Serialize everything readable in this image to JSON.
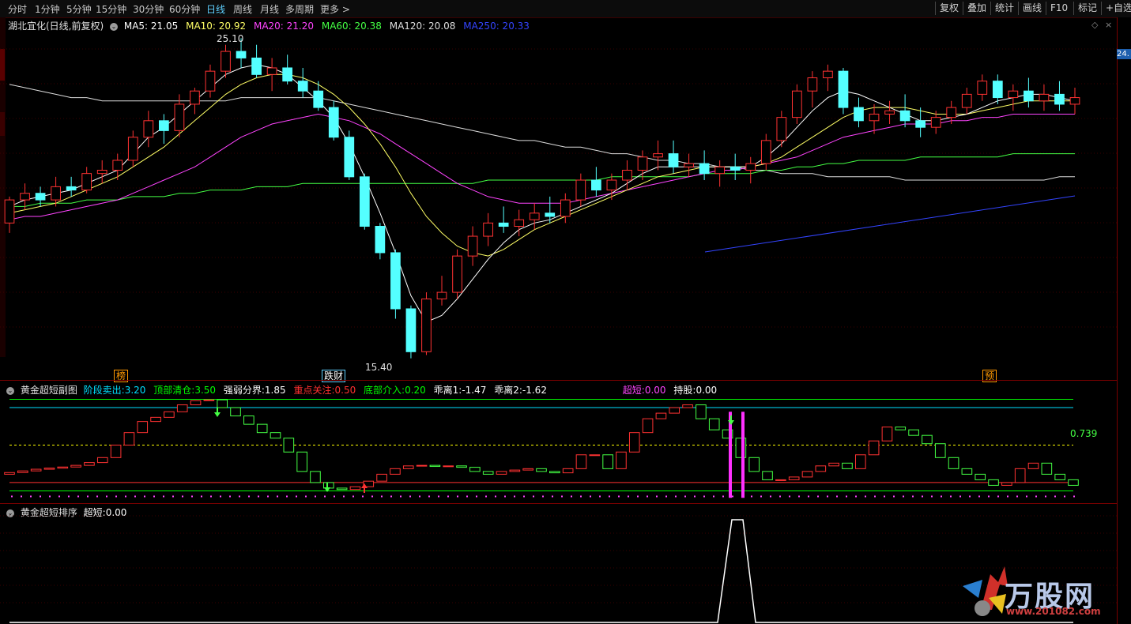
{
  "toolbar": {
    "periods": [
      "分时",
      "1分钟",
      "5分钟",
      "15分钟",
      "30分钟",
      "60分钟",
      "日线",
      "周线",
      "月线",
      "多周期",
      "更多 >"
    ],
    "active_period": "日线",
    "buttons": [
      "复权",
      "叠加",
      "统计",
      "画线",
      "F10",
      "标记",
      "+自选"
    ],
    "close": "×"
  },
  "main_chart": {
    "title": "湖北宜化(日线,前复权)",
    "ma": [
      {
        "label": "MA5: 21.05",
        "color": "#ffffff"
      },
      {
        "label": "MA10: 20.92",
        "color": "#ffff66"
      },
      {
        "label": "MA20: 21.20",
        "color": "#ff44ff"
      },
      {
        "label": "MA60: 20.38",
        "color": "#44ff44"
      },
      {
        "label": "MA120: 20.08",
        "color": "#dddddd"
      },
      {
        "label": "MA250: 20.33",
        "color": "#3344ff"
      }
    ],
    "high_label": "25.10",
    "low_label": "15.40",
    "current_price": "24.",
    "tags": [
      {
        "text": "榜",
        "color": "#ff9900"
      },
      {
        "text": "跌财",
        "color": "#ffffff"
      },
      {
        "text": "预",
        "color": "#ff9900"
      }
    ],
    "ohlc": [
      [
        19.5,
        20.3,
        19.2,
        20.2
      ],
      [
        20.2,
        20.7,
        19.9,
        20.4
      ],
      [
        20.4,
        20.6,
        20.0,
        20.2
      ],
      [
        20.2,
        20.9,
        20.0,
        20.6
      ],
      [
        20.6,
        20.9,
        20.3,
        20.5
      ],
      [
        20.5,
        21.2,
        20.4,
        21.0
      ],
      [
        21.0,
        21.4,
        20.7,
        21.1
      ],
      [
        21.1,
        21.6,
        20.8,
        21.4
      ],
      [
        21.4,
        22.3,
        21.2,
        22.1
      ],
      [
        22.1,
        22.9,
        21.8,
        22.6
      ],
      [
        22.6,
        22.8,
        21.9,
        22.3
      ],
      [
        22.3,
        23.4,
        22.1,
        23.1
      ],
      [
        23.1,
        23.6,
        22.8,
        23.5
      ],
      [
        23.5,
        24.3,
        23.3,
        24.1
      ],
      [
        24.1,
        24.9,
        23.9,
        24.7
      ],
      [
        24.7,
        25.1,
        24.2,
        24.5
      ],
      [
        24.5,
        24.9,
        23.9,
        24.0
      ],
      [
        24.0,
        24.5,
        23.5,
        24.2
      ],
      [
        24.2,
        24.6,
        23.7,
        23.8
      ],
      [
        23.8,
        24.2,
        23.3,
        23.5
      ],
      [
        23.5,
        23.8,
        22.9,
        23.0
      ],
      [
        23.0,
        23.2,
        22.0,
        22.1
      ],
      [
        22.1,
        22.3,
        20.8,
        20.9
      ],
      [
        20.9,
        21.0,
        19.3,
        19.4
      ],
      [
        19.4,
        19.5,
        18.4,
        18.6
      ],
      [
        18.6,
        18.7,
        16.6,
        16.9
      ],
      [
        16.9,
        17.0,
        15.4,
        15.6
      ],
      [
        15.6,
        17.4,
        15.5,
        17.2
      ],
      [
        17.2,
        17.9,
        17.0,
        17.4
      ],
      [
        17.4,
        18.7,
        17.2,
        18.5
      ],
      [
        18.5,
        19.4,
        18.2,
        19.1
      ],
      [
        19.1,
        19.8,
        18.8,
        19.5
      ],
      [
        19.5,
        20.0,
        19.2,
        19.4
      ],
      [
        19.4,
        19.9,
        19.1,
        19.6
      ],
      [
        19.6,
        20.1,
        19.3,
        19.8
      ],
      [
        19.8,
        20.3,
        19.5,
        19.7
      ],
      [
        19.7,
        20.4,
        19.5,
        20.2
      ],
      [
        20.2,
        21.0,
        20.0,
        20.8
      ],
      [
        20.8,
        21.2,
        20.3,
        20.5
      ],
      [
        20.5,
        21.0,
        20.2,
        20.8
      ],
      [
        20.8,
        21.4,
        20.5,
        21.1
      ],
      [
        21.1,
        21.7,
        20.8,
        21.5
      ],
      [
        21.5,
        22.0,
        21.1,
        21.6
      ],
      [
        21.6,
        22.0,
        21.0,
        21.2
      ],
      [
        21.2,
        21.6,
        20.9,
        21.3
      ],
      [
        21.3,
        21.7,
        20.8,
        21.0
      ],
      [
        21.0,
        21.4,
        20.6,
        21.2
      ],
      [
        21.2,
        21.6,
        20.8,
        21.1
      ],
      [
        21.1,
        21.5,
        20.7,
        21.3
      ],
      [
        21.3,
        22.2,
        21.1,
        22.0
      ],
      [
        22.0,
        22.9,
        21.8,
        22.7
      ],
      [
        22.7,
        23.7,
        22.5,
        23.5
      ],
      [
        23.5,
        24.1,
        23.0,
        23.9
      ],
      [
        23.9,
        24.3,
        23.5,
        24.1
      ],
      [
        24.1,
        24.2,
        22.8,
        23.0
      ],
      [
        23.0,
        23.3,
        22.4,
        22.6
      ],
      [
        22.6,
        23.1,
        22.2,
        22.8
      ],
      [
        22.8,
        23.2,
        22.5,
        22.9
      ],
      [
        22.9,
        23.4,
        22.4,
        22.6
      ],
      [
        22.6,
        23.0,
        22.1,
        22.4
      ],
      [
        22.4,
        22.9,
        22.2,
        22.7
      ],
      [
        22.7,
        23.2,
        22.5,
        23.0
      ],
      [
        23.0,
        23.6,
        22.8,
        23.4
      ],
      [
        23.4,
        24.0,
        23.2,
        23.8
      ],
      [
        23.8,
        24.0,
        23.1,
        23.3
      ],
      [
        23.3,
        23.7,
        22.9,
        23.5
      ],
      [
        23.5,
        23.9,
        23.0,
        23.2
      ],
      [
        23.2,
        23.7,
        22.9,
        23.4
      ],
      [
        23.4,
        23.8,
        22.9,
        23.1
      ],
      [
        23.1,
        23.6,
        22.8,
        23.3
      ]
    ],
    "ma5": [
      20.0,
      20.2,
      20.3,
      20.4,
      20.5,
      20.7,
      20.9,
      21.1,
      21.6,
      22.1,
      22.4,
      22.8,
      23.2,
      23.6,
      24.0,
      24.2,
      24.3,
      24.2,
      24.0,
      23.6,
      23.2,
      22.7,
      21.9,
      20.9,
      19.8,
      18.6,
      17.3,
      16.5,
      16.7,
      17.2,
      17.8,
      18.4,
      18.9,
      19.3,
      19.5,
      19.6,
      19.8,
      20.0,
      20.2,
      20.4,
      20.7,
      21.0,
      21.2,
      21.2,
      21.2,
      21.2,
      21.2,
      21.2,
      21.2,
      21.5,
      21.9,
      22.4,
      22.9,
      23.3,
      23.5,
      23.4,
      23.2,
      23.0,
      22.8,
      22.6,
      22.6,
      22.7,
      22.8,
      23.0,
      23.2,
      23.3,
      23.4,
      23.4,
      23.3,
      23.2
    ],
    "ma10": [
      19.8,
      19.9,
      20.0,
      20.1,
      20.3,
      20.5,
      20.7,
      20.9,
      21.2,
      21.5,
      21.8,
      22.2,
      22.6,
      23.0,
      23.4,
      23.7,
      23.9,
      24.0,
      24.0,
      23.9,
      23.7,
      23.4,
      23.0,
      22.5,
      21.9,
      21.2,
      20.4,
      19.7,
      19.2,
      18.8,
      18.6,
      18.5,
      18.7,
      19.0,
      19.3,
      19.5,
      19.7,
      19.9,
      20.1,
      20.3,
      20.5,
      20.7,
      20.9,
      21.0,
      21.1,
      21.2,
      21.2,
      21.2,
      21.2,
      21.3,
      21.5,
      21.8,
      22.1,
      22.4,
      22.7,
      22.9,
      23.0,
      23.0,
      23.0,
      22.9,
      22.8,
      22.8,
      22.8,
      22.9,
      23.0,
      23.1,
      23.2,
      23.2,
      23.2,
      23.2
    ],
    "ma20": [
      19.6,
      19.7,
      19.7,
      19.8,
      19.9,
      20.0,
      20.1,
      20.2,
      20.4,
      20.6,
      20.8,
      21.0,
      21.2,
      21.5,
      21.8,
      22.1,
      22.3,
      22.5,
      22.6,
      22.7,
      22.8,
      22.7,
      22.6,
      22.4,
      22.2,
      21.9,
      21.6,
      21.3,
      21.0,
      20.7,
      20.5,
      20.3,
      20.2,
      20.1,
      20.1,
      20.1,
      20.1,
      20.2,
      20.3,
      20.4,
      20.5,
      20.6,
      20.7,
      20.8,
      20.9,
      21.0,
      21.1,
      21.1,
      21.2,
      21.3,
      21.4,
      21.5,
      21.7,
      21.9,
      22.1,
      22.2,
      22.3,
      22.4,
      22.5,
      22.5,
      22.5,
      22.6,
      22.6,
      22.7,
      22.7,
      22.8,
      22.8,
      22.8,
      22.8,
      22.8
    ],
    "ma60": [
      20.0,
      20.0,
      20.1,
      20.1,
      20.1,
      20.2,
      20.2,
      20.2,
      20.3,
      20.3,
      20.3,
      20.4,
      20.4,
      20.5,
      20.5,
      20.5,
      20.6,
      20.6,
      20.6,
      20.7,
      20.7,
      20.7,
      20.7,
      20.7,
      20.7,
      20.7,
      20.7,
      20.7,
      20.7,
      20.7,
      20.7,
      20.8,
      20.8,
      20.8,
      20.8,
      20.8,
      20.8,
      20.8,
      20.8,
      20.9,
      20.9,
      20.9,
      20.9,
      20.9,
      20.9,
      21.0,
      21.0,
      21.0,
      21.0,
      21.1,
      21.1,
      21.2,
      21.2,
      21.3,
      21.3,
      21.4,
      21.4,
      21.4,
      21.4,
      21.5,
      21.5,
      21.5,
      21.5,
      21.5,
      21.5,
      21.6,
      21.6,
      21.6,
      21.6,
      21.6
    ],
    "ma120": [
      23.7,
      23.6,
      23.5,
      23.4,
      23.3,
      23.3,
      23.2,
      23.2,
      23.2,
      23.2,
      23.2,
      23.2,
      23.2,
      23.2,
      23.2,
      23.3,
      23.3,
      23.3,
      23.3,
      23.3,
      23.3,
      23.2,
      23.1,
      23.0,
      22.9,
      22.8,
      22.7,
      22.6,
      22.5,
      22.4,
      22.3,
      22.2,
      22.1,
      22.0,
      22.0,
      21.9,
      21.8,
      21.8,
      21.7,
      21.6,
      21.6,
      21.5,
      21.4,
      21.4,
      21.3,
      21.3,
      21.2,
      21.2,
      21.1,
      21.1,
      21.0,
      21.0,
      21.0,
      20.9,
      20.9,
      20.9,
      20.9,
      20.9,
      20.8,
      20.8,
      20.8,
      20.8,
      20.8,
      20.8,
      20.8,
      20.8,
      20.8,
      20.8,
      20.9,
      20.9
    ]
  },
  "sub_chart1": {
    "title": "黄金超短副图",
    "items": [
      {
        "label": "阶段卖出:",
        "value": "3.20",
        "label_color": "#00e0ff"
      },
      {
        "label": "顶部清仓:",
        "value": "3.50",
        "label_color": "#00ff00"
      },
      {
        "label": "强弱分界:",
        "value": "1.85",
        "label_color": "#ffffff"
      },
      {
        "label": "重点关注:",
        "value": "0.50",
        "label_color": "#ff3030"
      },
      {
        "label": "底部介入:",
        "value": "0.20",
        "label_color": "#00ff00"
      },
      {
        "label": "乖离1:",
        "value": "-1.47",
        "label_color": "#ffffff"
      },
      {
        "label": "乖离2:",
        "value": "-1.62",
        "label_color": "#ffffff"
      },
      {
        "label": "超短:",
        "value": "0.00",
        "label_color": "#ff44ff"
      },
      {
        "label": "持股:",
        "value": "0.00",
        "label_color": "#ffffff"
      }
    ],
    "right_value": "0.739",
    "ohlc": [
      [
        0.8,
        0.86
      ],
      [
        0.86,
        0.92
      ],
      [
        0.92,
        0.98
      ],
      [
        0.98,
        1.02
      ],
      [
        1.02,
        1.06
      ],
      [
        1.06,
        1.12
      ],
      [
        1.12,
        1.22
      ],
      [
        1.22,
        1.4
      ],
      [
        1.4,
        1.85
      ],
      [
        1.85,
        2.3
      ],
      [
        2.3,
        2.7
      ],
      [
        2.7,
        2.85
      ],
      [
        2.85,
        3.05
      ],
      [
        3.05,
        3.3
      ],
      [
        3.3,
        3.45
      ],
      [
        3.45,
        3.48
      ],
      [
        3.48,
        3.2
      ],
      [
        3.2,
        2.9
      ],
      [
        2.9,
        2.6
      ],
      [
        2.6,
        2.3
      ],
      [
        2.3,
        2.1
      ],
      [
        2.1,
        1.6
      ],
      [
        1.6,
        0.9
      ],
      [
        0.9,
        0.5
      ],
      [
        0.5,
        0.3
      ],
      [
        0.3,
        0.25
      ],
      [
        0.25,
        0.35
      ],
      [
        0.35,
        0.55
      ],
      [
        0.55,
        0.8
      ],
      [
        0.8,
        1.0
      ],
      [
        1.0,
        1.1
      ],
      [
        1.1,
        1.12
      ],
      [
        1.12,
        1.08
      ],
      [
        1.08,
        1.1
      ],
      [
        1.1,
        1.05
      ],
      [
        1.05,
        0.9
      ],
      [
        0.9,
        0.8
      ],
      [
        0.8,
        0.9
      ],
      [
        0.9,
        0.95
      ],
      [
        0.95,
        1.0
      ],
      [
        1.0,
        0.9
      ],
      [
        0.9,
        0.85
      ],
      [
        0.85,
        1.0
      ],
      [
        1.0,
        1.5
      ],
      [
        1.5,
        1.5
      ],
      [
        1.5,
        1.0
      ],
      [
        1.0,
        1.6
      ],
      [
        1.6,
        2.3
      ],
      [
        2.3,
        2.8
      ],
      [
        2.8,
        3.0
      ],
      [
        3.0,
        3.2
      ],
      [
        3.2,
        3.3
      ],
      [
        3.3,
        2.8
      ],
      [
        2.8,
        2.4
      ],
      [
        2.4,
        2.1
      ],
      [
        2.1,
        1.4
      ],
      [
        1.4,
        0.9
      ],
      [
        0.9,
        0.6
      ],
      [
        0.6,
        0.6
      ],
      [
        0.6,
        0.7
      ],
      [
        0.7,
        0.9
      ],
      [
        0.9,
        1.1
      ],
      [
        1.1,
        1.2
      ],
      [
        1.2,
        1.0
      ],
      [
        1.0,
        1.5
      ],
      [
        1.5,
        2.0
      ],
      [
        2.0,
        2.5
      ],
      [
        2.5,
        2.4
      ],
      [
        2.4,
        2.2
      ],
      [
        2.2,
        1.9
      ],
      [
        1.9,
        1.4
      ],
      [
        1.4,
        1.0
      ],
      [
        1.0,
        0.8
      ],
      [
        0.8,
        0.6
      ],
      [
        0.6,
        0.4
      ],
      [
        0.4,
        0.5
      ],
      [
        0.5,
        1.0
      ],
      [
        1.0,
        1.2
      ],
      [
        1.2,
        0.8
      ],
      [
        0.8,
        0.6
      ],
      [
        0.6,
        0.4
      ]
    ]
  },
  "sub_chart2": {
    "title": "黄金超短排序",
    "items": [
      {
        "label": "超短:",
        "value": "0.00",
        "label_color": "#ffffff"
      }
    ]
  },
  "watermark": {
    "brand": "万股网",
    "url": "www.201082.com"
  }
}
